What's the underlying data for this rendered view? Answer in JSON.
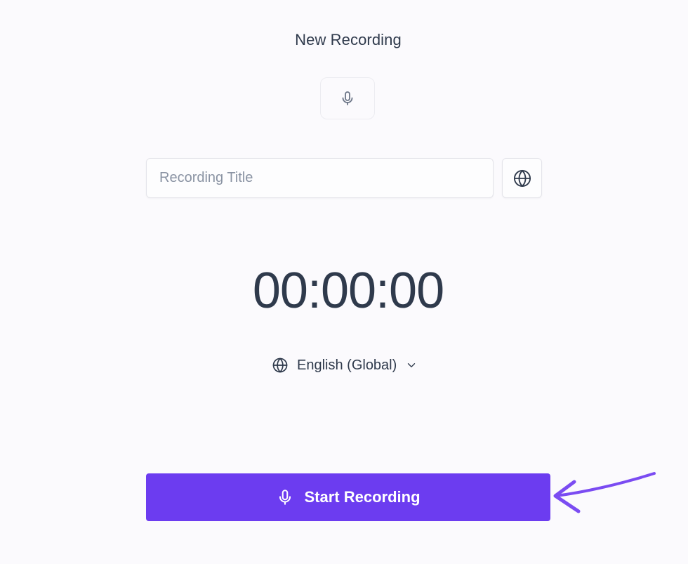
{
  "header": {
    "title": "New Recording"
  },
  "recording": {
    "title_placeholder": "Recording Title",
    "title_value": "",
    "timer": "00:00:00",
    "language": "English (Global)",
    "start_label": "Start Recording"
  },
  "icons": {
    "mic": "microphone-icon",
    "globe": "globe-icon",
    "chevron": "chevron-down-icon",
    "arrow": "hand-drawn-arrow"
  },
  "colors": {
    "accent": "#6c3cf0",
    "arrow": "#7b4cf2",
    "text": "#2f3a4c",
    "placeholder": "#8a93a3",
    "background": "#fbfafd"
  }
}
